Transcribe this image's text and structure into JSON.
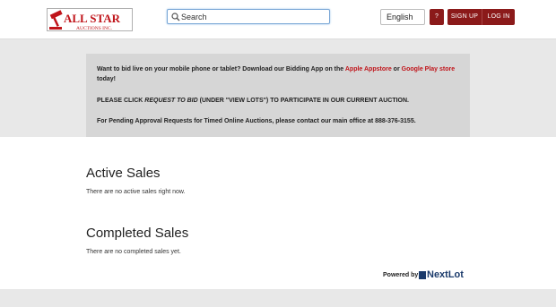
{
  "logo": {
    "line1": "ALL STAR",
    "line2": "AUCTIONS INC."
  },
  "search": {
    "placeholder": "Search"
  },
  "language": {
    "selected": "English"
  },
  "help_label": "?",
  "auth": {
    "signup": "SIGN UP",
    "login": "LOG IN"
  },
  "notice": {
    "p1_a": "Want to bid live on your mobile phone or tablet?  Download our Bidding App on the ",
    "p1_link1": "Apple Appstore",
    "p1_b": " or ",
    "p1_link2": "Google Play store",
    "p1_c": " today!",
    "p2_a": "PLEASE CLICK ",
    "p2_italic": "REQUEST TO BID",
    "p2_b": " (UNDER \"VIEW LOTS\") TO PARTICIPATE IN OUR CURRENT AUCTION.",
    "p3": "For Pending Approval Requests for Timed Online Auctions, please contact our main office at 888-376-3155."
  },
  "active_sales": {
    "title": "Active Sales",
    "empty": "There are no active sales right now."
  },
  "completed_sales": {
    "title": "Completed Sales",
    "empty": "There are no completed sales yet."
  },
  "powered_by": {
    "label": "Powered by",
    "brand": "NextLot"
  },
  "colors": {
    "accent": "#8b1a1a",
    "link_red": "#c0141a",
    "nextlot_blue": "#1a3a6b"
  }
}
